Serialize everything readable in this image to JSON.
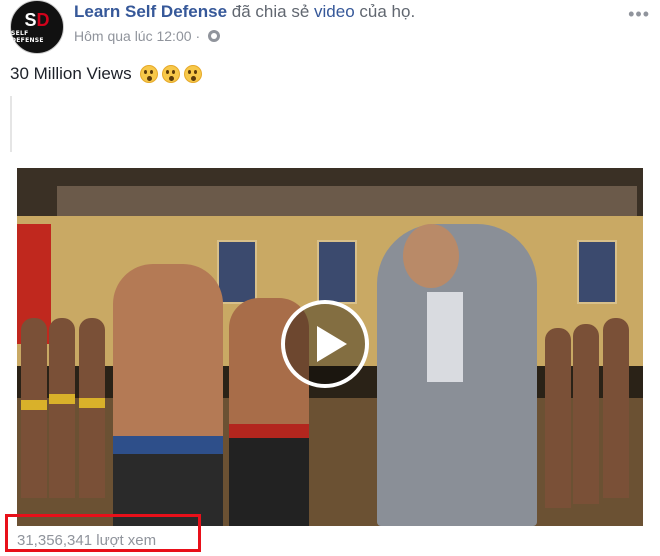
{
  "header": {
    "avatar": {
      "mark": "S",
      "mark_dot": "D",
      "brand": "SELF DEFENSE"
    },
    "page_name": "Learn Self Defense",
    "action_text": "đã chia sẻ",
    "video_link": "video",
    "action_suffix": "của họ.",
    "timestamp": "Hôm qua lúc 12:00",
    "separator": "·",
    "privacy_icon": "globe-icon",
    "more_icon": "ellipsis-icon",
    "more_glyph": "•••"
  },
  "post": {
    "text": "30 Million Views",
    "emoji_count": 3,
    "emoji_icon": "astonished-face-icon"
  },
  "video": {
    "play_icon": "play-icon",
    "view_count": "31,356,341 lượt xem"
  },
  "colors": {
    "link": "#365899",
    "meta": "#90949c",
    "highlight": "#e8101a"
  }
}
